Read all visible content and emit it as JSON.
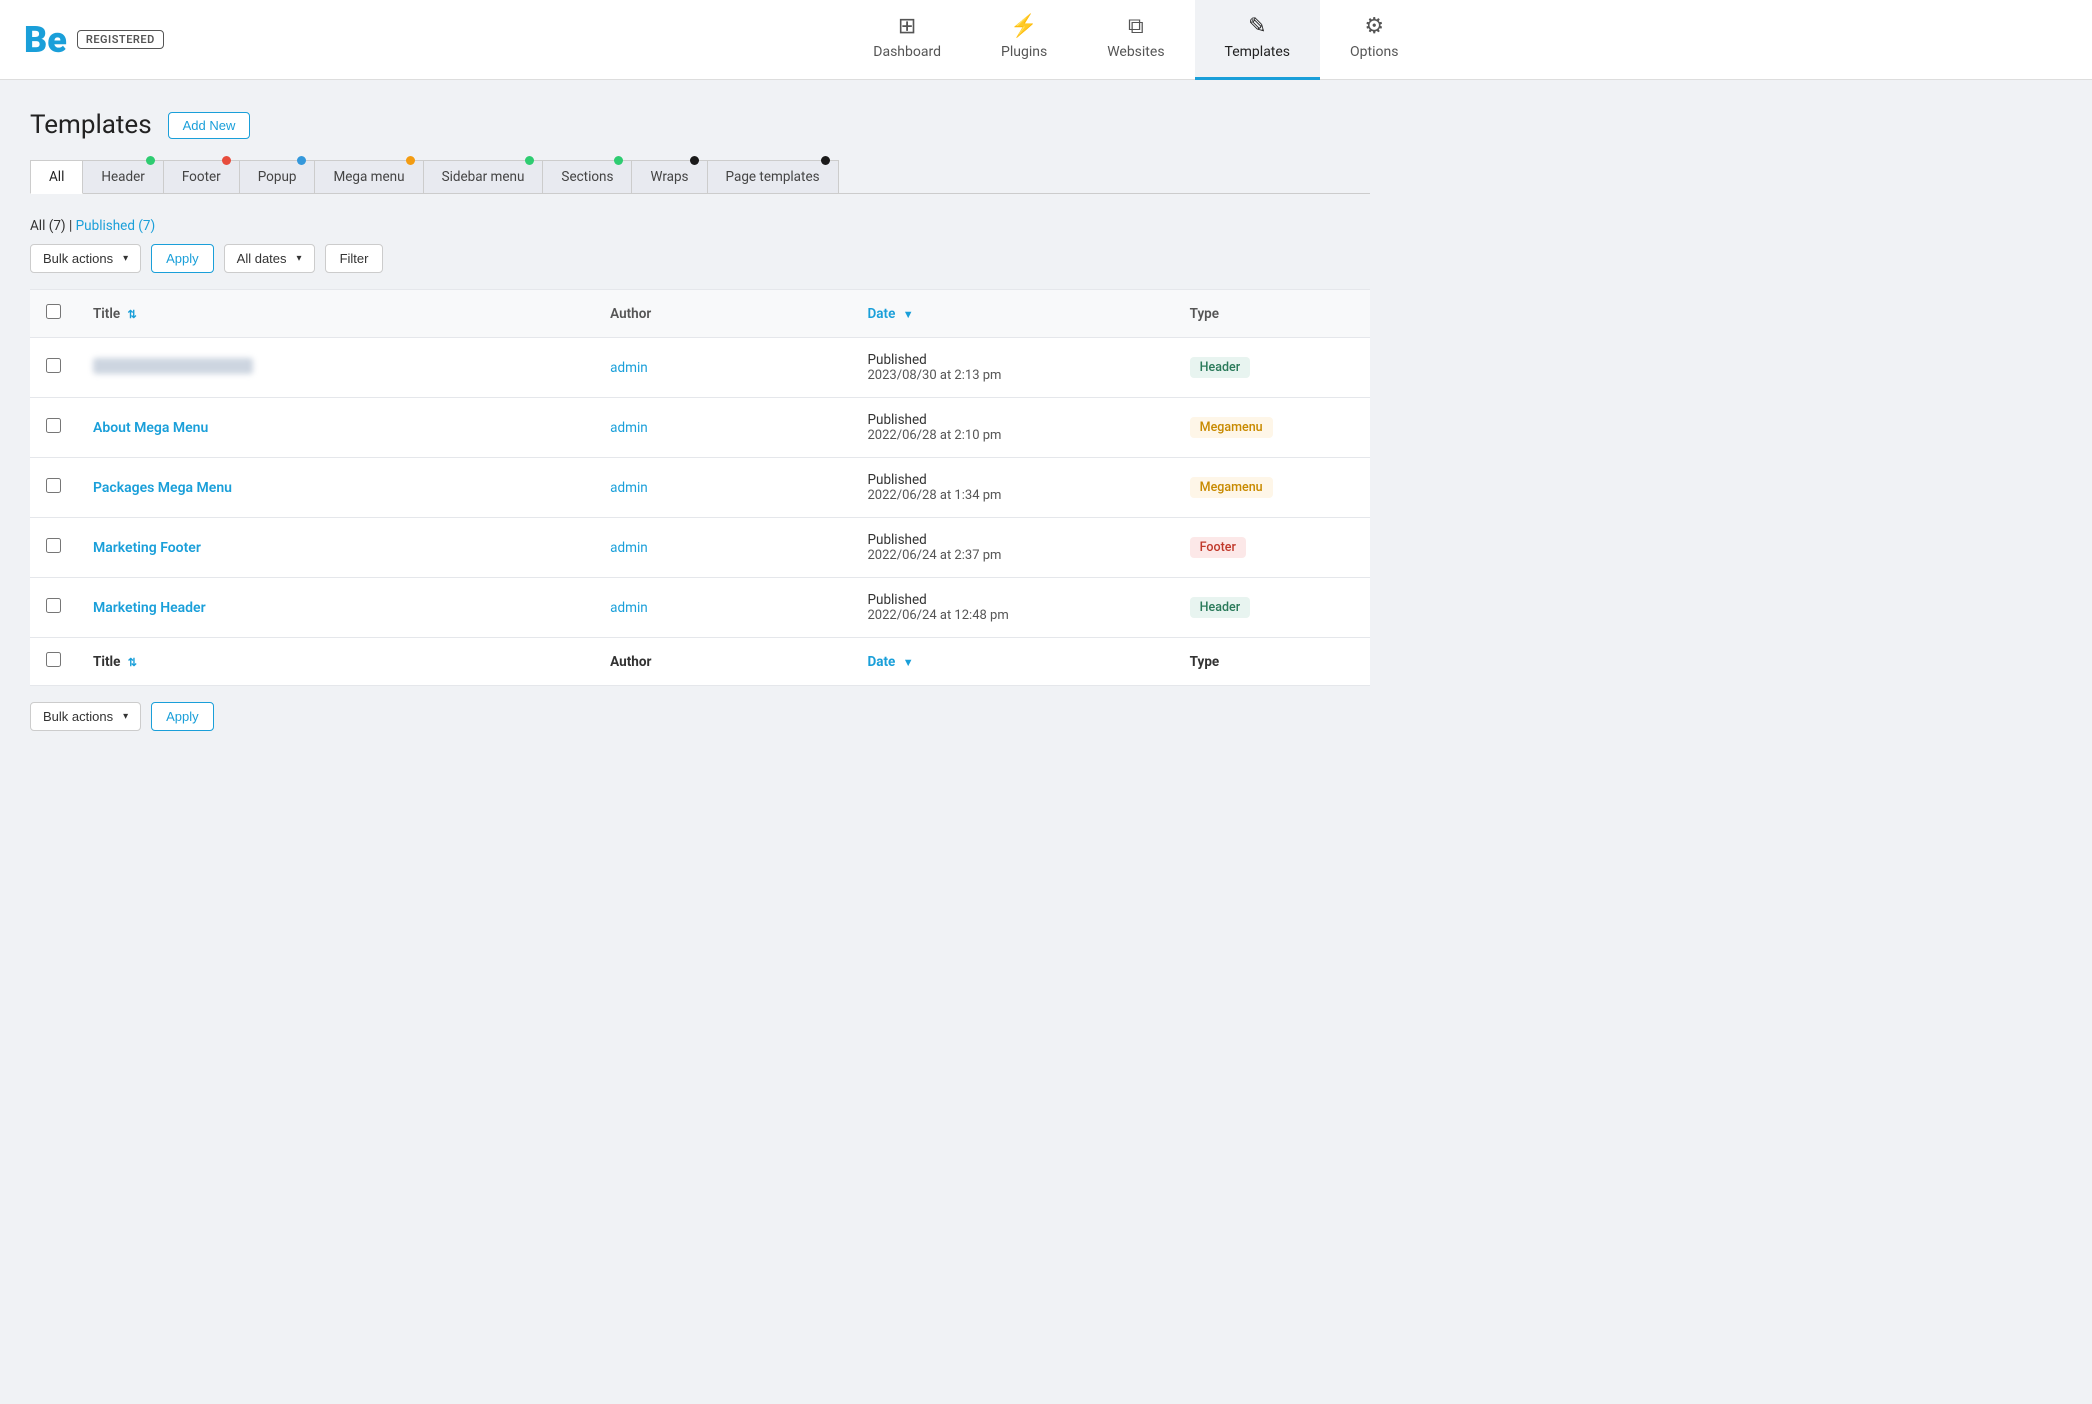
{
  "brand": {
    "logo": "Be",
    "badge": "REGISTERED"
  },
  "nav": {
    "items": [
      {
        "id": "dashboard",
        "label": "Dashboard",
        "icon": "⊞",
        "active": false
      },
      {
        "id": "plugins",
        "label": "Plugins",
        "icon": "🔌",
        "active": false
      },
      {
        "id": "websites",
        "label": "Websites",
        "icon": "❐",
        "active": false
      },
      {
        "id": "templates",
        "label": "Templates",
        "icon": "✎",
        "active": true
      },
      {
        "id": "options",
        "label": "Options",
        "icon": "⚙",
        "active": false
      }
    ]
  },
  "page": {
    "title": "Templates",
    "add_new_label": "Add New"
  },
  "tabs": [
    {
      "id": "all",
      "label": "All",
      "active": true,
      "dot_color": "#1a1a1a"
    },
    {
      "id": "header",
      "label": "Header",
      "active": false,
      "dot_color": "#2ecc71"
    },
    {
      "id": "footer",
      "label": "Footer",
      "active": false,
      "dot_color": "#e74c3c"
    },
    {
      "id": "popup",
      "label": "Popup",
      "active": false,
      "dot_color": "#3498db"
    },
    {
      "id": "mega-menu",
      "label": "Mega menu",
      "active": false,
      "dot_color": "#f39c12"
    },
    {
      "id": "sidebar-menu",
      "label": "Sidebar menu",
      "active": false,
      "dot_color": "#2ecc71"
    },
    {
      "id": "sections",
      "label": "Sections",
      "active": false,
      "dot_color": "#2ecc71"
    },
    {
      "id": "wraps",
      "label": "Wraps",
      "active": false,
      "dot_color": "#1a1a1a"
    },
    {
      "id": "page-templates",
      "label": "Page templates",
      "active": false,
      "dot_color": "#1a1a1a"
    }
  ],
  "filter": {
    "summary_all": "All (7)",
    "summary_sep": "|",
    "summary_published": "Published (7)",
    "bulk_actions_label": "Bulk actions",
    "apply_label": "Apply",
    "all_dates_label": "All dates",
    "filter_label": "Filter"
  },
  "table": {
    "headers": {
      "title": "Title",
      "author": "Author",
      "date": "Date",
      "type": "Type"
    },
    "rows": [
      {
        "id": 1,
        "title_blurred": true,
        "title": "",
        "author": "admin",
        "status": "Published",
        "date": "2023/08/30 at 2:13 pm",
        "type": "Header",
        "type_class": "badge-header"
      },
      {
        "id": 2,
        "title_blurred": false,
        "title": "About Mega Menu",
        "author": "admin",
        "status": "Published",
        "date": "2022/06/28 at 2:10 pm",
        "type": "Megamenu",
        "type_class": "badge-megamenu"
      },
      {
        "id": 3,
        "title_blurred": false,
        "title": "Packages Mega Menu",
        "author": "admin",
        "status": "Published",
        "date": "2022/06/28 at 1:34 pm",
        "type": "Megamenu",
        "type_class": "badge-megamenu"
      },
      {
        "id": 4,
        "title_blurred": false,
        "title": "Marketing Footer",
        "author": "admin",
        "status": "Published",
        "date": "2022/06/24 at 2:37 pm",
        "type": "Footer",
        "type_class": "badge-footer"
      },
      {
        "id": 5,
        "title_blurred": false,
        "title": "Marketing Header",
        "author": "admin",
        "status": "Published",
        "date": "2022/06/24 at 12:48 pm",
        "type": "Header",
        "type_class": "badge-header"
      }
    ]
  },
  "bottom_filter": {
    "bulk_actions_label": "Bulk actions",
    "apply_label": "Apply"
  }
}
